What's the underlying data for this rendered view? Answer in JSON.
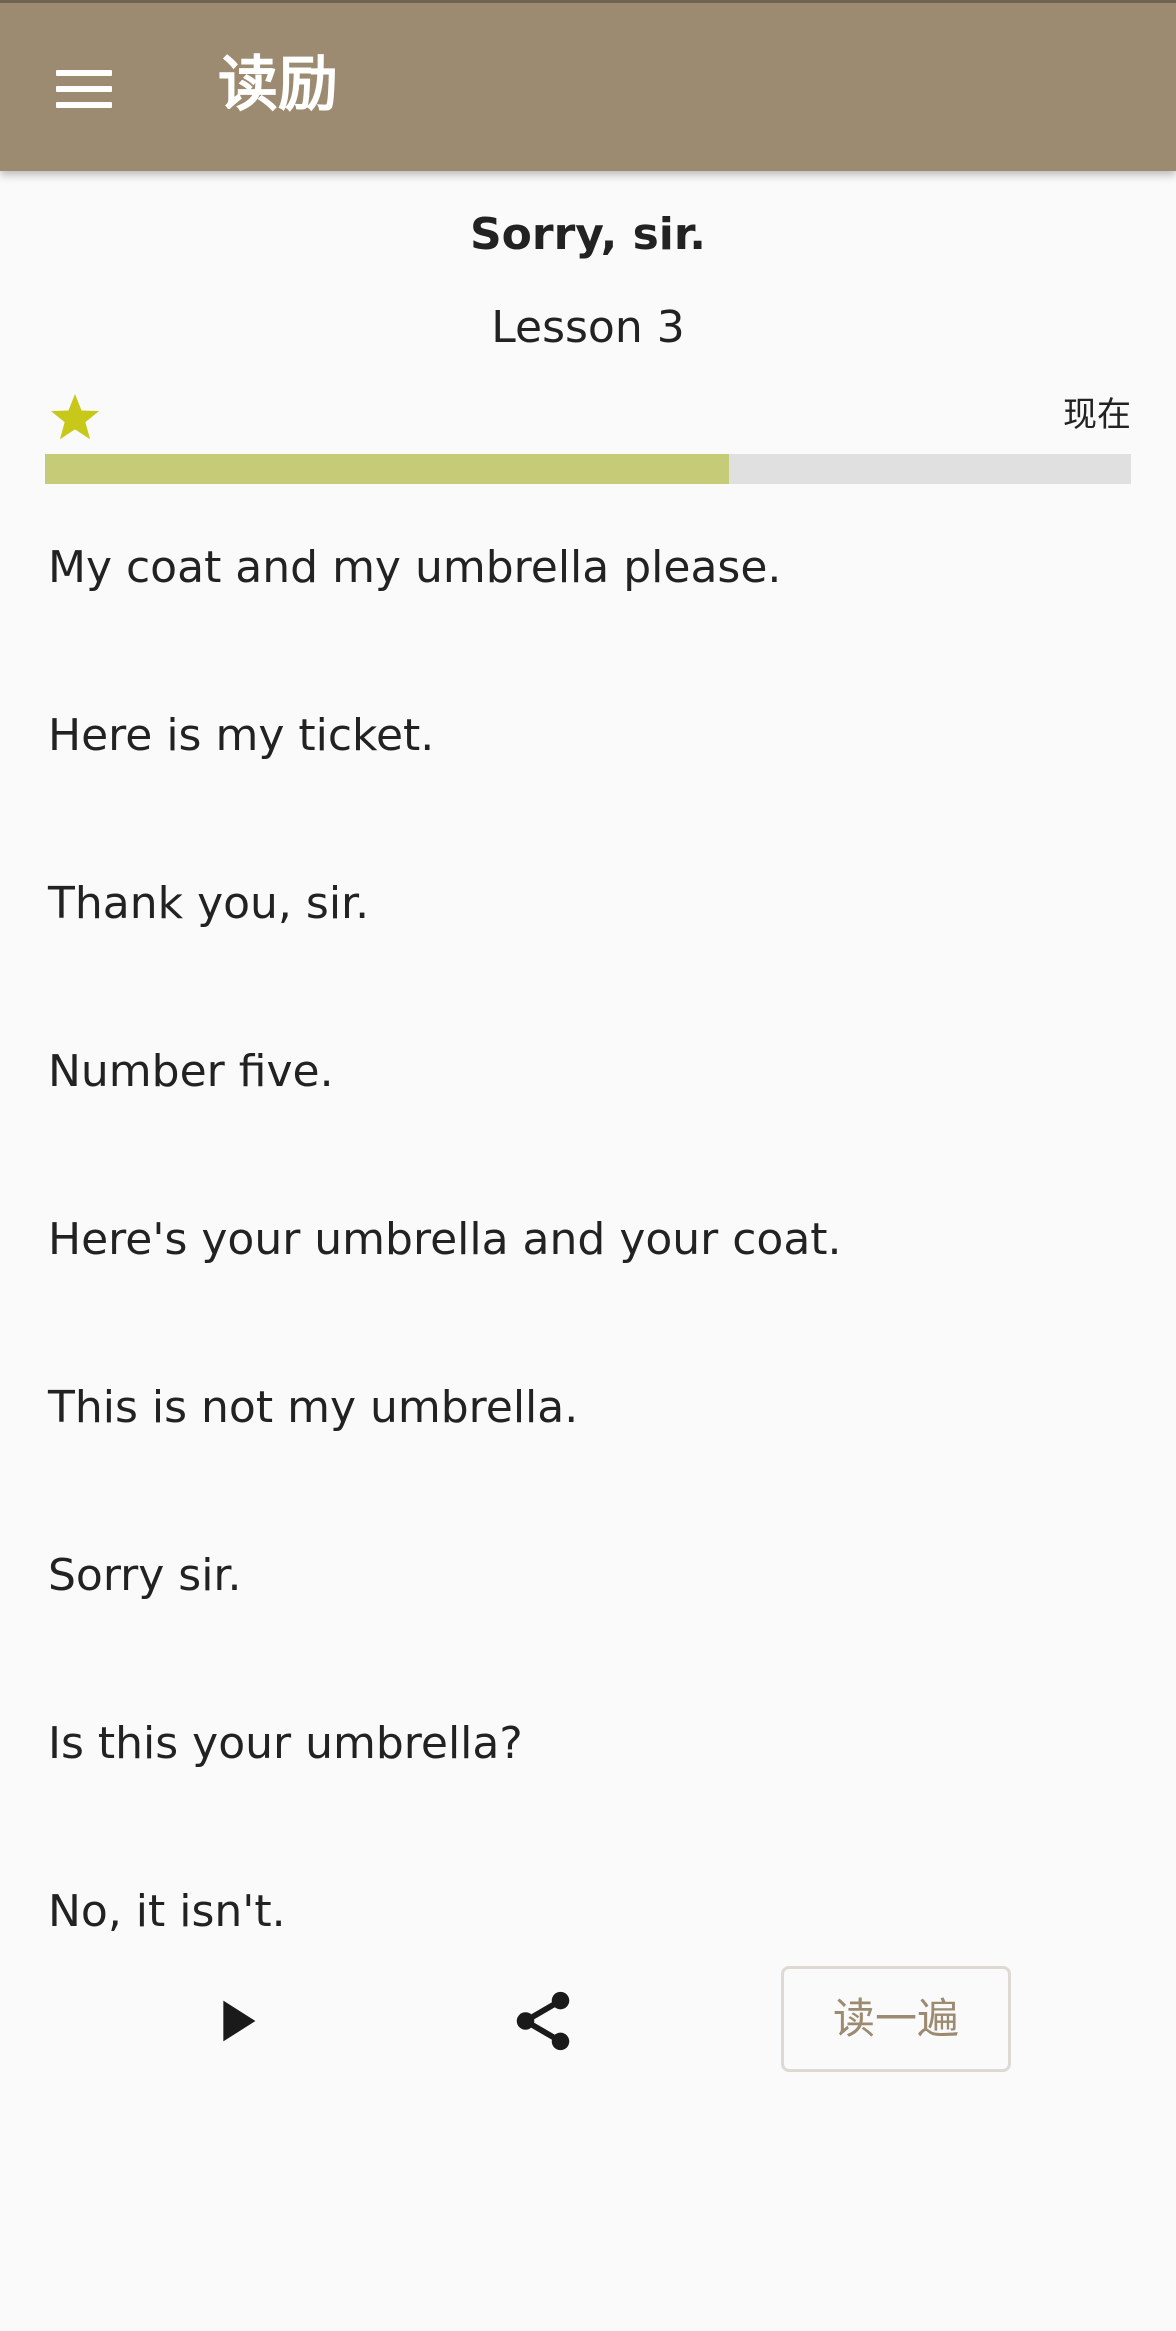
{
  "app_bar": {
    "title": "读励",
    "menu_icon": "hamburger-menu-icon",
    "background_color": "#9c8b70"
  },
  "lesson": {
    "title": "Sorry, sir.",
    "number_label": "Lesson 3"
  },
  "progress": {
    "star_icon": "star-icon",
    "star_color": "#c8c81a",
    "timestamp": "现在",
    "fraction": 0.63,
    "fill_color": "#c5cb77",
    "track_color": "#e0e0e0"
  },
  "sentences": [
    "My coat and my umbrella please.",
    "Here is my ticket.",
    "Thank you, sir.",
    "Number five.",
    "Here's your umbrella and your coat.",
    "This is not my umbrella.",
    "Sorry sir.",
    "Is this your umbrella?",
    "No, it isn't."
  ],
  "controls": {
    "play_icon": "play-icon",
    "share_icon": "share-icon",
    "read_button_label": "读一遍"
  }
}
